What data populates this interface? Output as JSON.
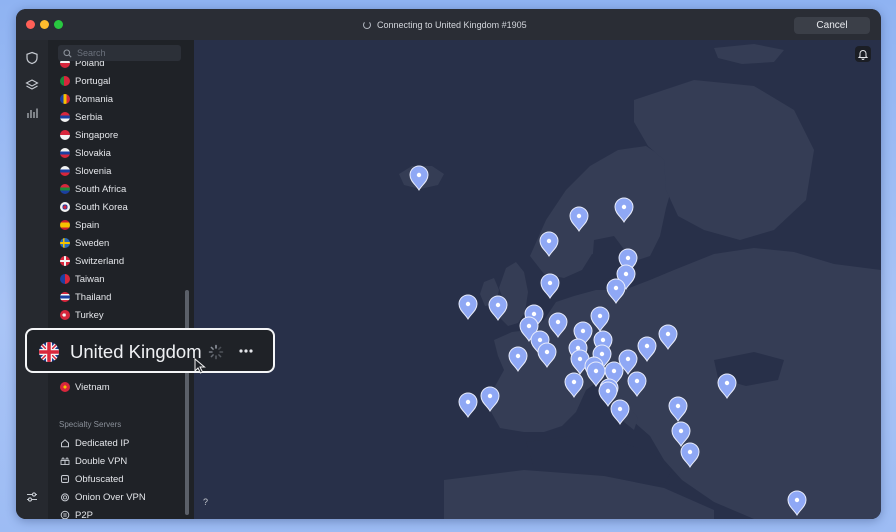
{
  "titlebar": {
    "status_text": "Connecting to United Kingdom #1905",
    "cancel_label": "Cancel"
  },
  "rail": {
    "icons": [
      "shield-icon",
      "layers-icon",
      "stats-icon",
      "settings-sliders-icon"
    ]
  },
  "sidebar": {
    "search_placeholder": "Search",
    "partial_top_item": "Poland",
    "countries": [
      {
        "name": "Portugal"
      },
      {
        "name": "Romania"
      },
      {
        "name": "Serbia"
      },
      {
        "name": "Singapore"
      },
      {
        "name": "Slovakia"
      },
      {
        "name": "Slovenia"
      },
      {
        "name": "South Africa"
      },
      {
        "name": "South Korea"
      },
      {
        "name": "Spain"
      },
      {
        "name": "Sweden"
      },
      {
        "name": "Switzerland"
      },
      {
        "name": "Taiwan"
      },
      {
        "name": "Thailand"
      },
      {
        "name": "Turkey"
      }
    ],
    "after_highlight": [
      {
        "name": "Vietnam"
      }
    ],
    "specialty_title": "Specialty Servers",
    "specialty": [
      {
        "name": "Dedicated IP",
        "icon": "house-icon"
      },
      {
        "name": "Double VPN",
        "icon": "double-lock-icon"
      },
      {
        "name": "Obfuscated",
        "icon": "obfuscated-icon"
      },
      {
        "name": "Onion Over VPN",
        "icon": "onion-icon"
      },
      {
        "name": "P2P",
        "icon": "p2p-icon"
      }
    ]
  },
  "highlight": {
    "country": "United Kingdom",
    "flag": "uk-flag-icon",
    "state": "connecting"
  },
  "map": {
    "help_label": "?",
    "zoom_out_label": "−",
    "zoom_in_label": "+",
    "accent_color": "#8fa8f5",
    "background_color": "#283049",
    "land_color": "#353d55"
  }
}
